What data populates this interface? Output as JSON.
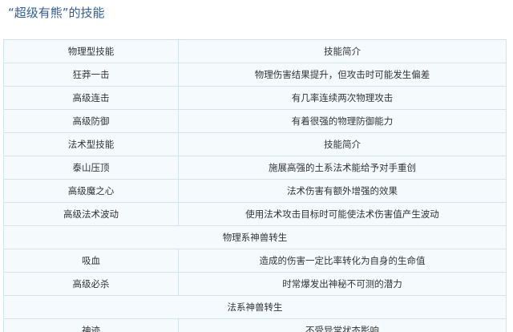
{
  "heading": "“超级有熊”的技能",
  "rows": [
    {
      "name": "物理型技能",
      "desc": "技能简介"
    },
    {
      "name": "狂莽一击",
      "desc": "物理伤害结果提升，但攻击时可能发生偏差"
    },
    {
      "name": "高级连击",
      "desc": "有几率连续两次物理攻击"
    },
    {
      "name": "高级防御",
      "desc": "有着很强的物理防御能力"
    },
    {
      "name": "法术型技能",
      "desc": "技能简介"
    },
    {
      "name": "泰山压顶",
      "desc": "施展高强的土系法术能给予对手重创"
    },
    {
      "name": "高级魔之心",
      "desc": "法术伤害有额外增强的效果"
    },
    {
      "name": "高级法术波动",
      "desc": "使用法术攻击目标时可能使法术伤害值产生波动"
    },
    {
      "section": "物理系神兽转生"
    },
    {
      "name": "吸血",
      "desc": "造成的伤害一定比率转化为自身的生命值"
    },
    {
      "name": "高级必杀",
      "desc": "时常爆发出神秘不可测的潜力"
    },
    {
      "section": "法系神兽转生"
    },
    {
      "name": "神迹",
      "desc": "不受异常状态影响"
    }
  ]
}
